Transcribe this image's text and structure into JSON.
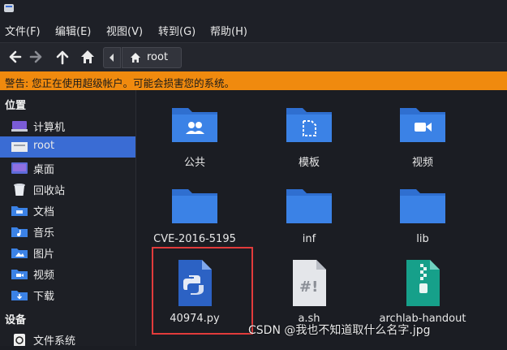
{
  "menu": [
    "文件(F)",
    "编辑(E)",
    "视图(V)",
    "转到(G)",
    "帮助(H)"
  ],
  "breadcrumb": {
    "current": "root"
  },
  "warning": "警告: 您正在使用超级帐户。可能会损害您的系统。",
  "sidebar": {
    "places_heading": "位置",
    "places": [
      {
        "label": "计算机",
        "icon": "computer-icon"
      },
      {
        "label": "root",
        "icon": "home-folder-icon",
        "active": true
      },
      {
        "label": "桌面",
        "icon": "desktop-icon"
      },
      {
        "label": "回收站",
        "icon": "trash-icon"
      },
      {
        "label": "文档",
        "icon": "documents-folder-icon"
      },
      {
        "label": "音乐",
        "icon": "music-folder-icon"
      },
      {
        "label": "图片",
        "icon": "pictures-folder-icon"
      },
      {
        "label": "视频",
        "icon": "videos-folder-icon"
      },
      {
        "label": "下载",
        "icon": "downloads-folder-icon"
      }
    ],
    "devices_heading": "设备",
    "devices": [
      {
        "label": "文件系统",
        "icon": "filesystem-icon"
      }
    ]
  },
  "files": [
    {
      "name": "公共",
      "icon": "public-folder-icon"
    },
    {
      "name": "模板",
      "icon": "templates-folder-icon"
    },
    {
      "name": "视频",
      "icon": "videos-folder-icon"
    },
    {
      "name": "CVE-2016-5195",
      "icon": "folder-icon"
    },
    {
      "name": "inf",
      "icon": "folder-icon"
    },
    {
      "name": "lib",
      "icon": "folder-icon"
    },
    {
      "name": "40974.py",
      "icon": "python-file-icon"
    },
    {
      "name": "a.sh",
      "icon": "shell-script-icon"
    },
    {
      "name": "archlab-handout",
      "icon": "archive-file-icon"
    }
  ],
  "watermark": "CSDN @我也不知道取什么名字.jpg",
  "colors": {
    "accent": "#3a6cd4",
    "warning": "#f08a0e",
    "folder": "#3b82e6",
    "highlight_box": "#e23b3b"
  }
}
